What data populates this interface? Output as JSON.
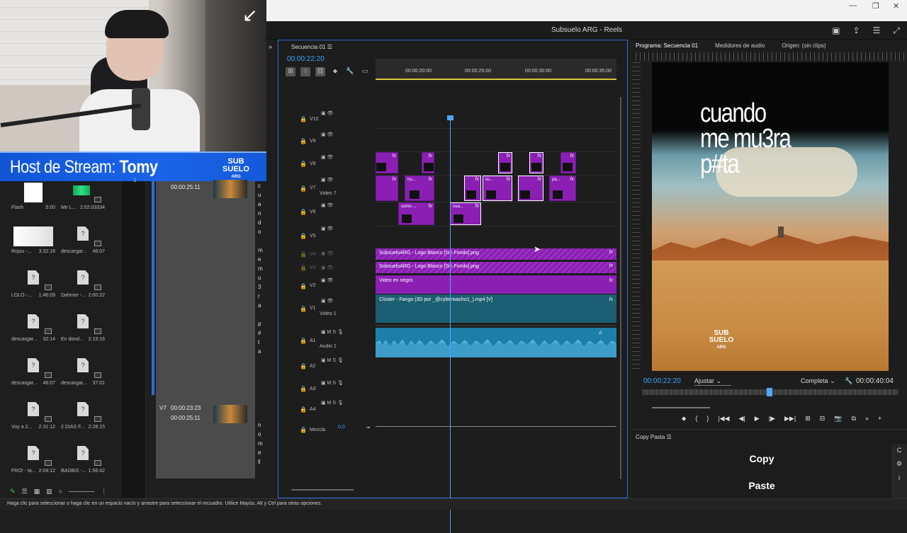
{
  "window": {
    "title": "Subsuelo ARG - Reels",
    "controls": [
      "—",
      "❐",
      "✕"
    ],
    "title_icons": [
      "▣",
      "⇪",
      "☰",
      "⤢"
    ]
  },
  "stream": {
    "banner_label": "Host de Stream:",
    "host_name": "Tomy",
    "logo_text": [
      "SUB",
      "SUELO",
      "ARG"
    ]
  },
  "project": {
    "items": [
      {
        "name": "Flash",
        "dur": "5:00",
        "kind": "white"
      },
      {
        "name": "Me L...",
        "dur": "2:02:03334",
        "kind": "audio"
      },
      {
        "name": "Rojuu -...",
        "dur": "3:32:18",
        "kind": "whiteimg"
      },
      {
        "name": "descargar...",
        "dur": "46:07",
        "kind": "doc"
      },
      {
        "name": "LOLO -...",
        "dur": "1:46:09",
        "kind": "doc"
      },
      {
        "name": "Dahmer -...",
        "dur": "2:00:22",
        "kind": "doc"
      },
      {
        "name": "descargar...",
        "dur": "32:14",
        "kind": "doc"
      },
      {
        "name": "En dond...",
        "dur": "2:19:16",
        "kind": "doc"
      },
      {
        "name": "descargar...",
        "dur": "46:07",
        "kind": "doc"
      },
      {
        "name": "descargar...",
        "dur": "37:01",
        "kind": "doc"
      },
      {
        "name": "Voy a 2...",
        "dur": "2:31:12",
        "kind": "doc"
      },
      {
        "name": "2 DIAS F...",
        "dur": "2:28:15",
        "kind": "doc"
      },
      {
        "name": "FRO! - ta...",
        "dur": "2:04:12",
        "kind": "doc"
      },
      {
        "name": "BADBIX -...",
        "dur": "1:56:42",
        "kind": "doc"
      }
    ],
    "tools": [
      "✎",
      "☰",
      "▦",
      "▥",
      "○",
      "⋮"
    ]
  },
  "captions": {
    "entries": [
      {
        "track": "",
        "in": "",
        "out": "00:00:25:11",
        "letters": [
          "c",
          "u",
          "a",
          "n",
          "d",
          "o",
          "",
          "m",
          "e",
          "m",
          "u",
          "3",
          "r",
          "a",
          "",
          "p",
          "#",
          "t",
          "a"
        ]
      },
      {
        "track": "V7",
        "in": "00:00:23:23",
        "out": "00:00:25:11",
        "letters": [
          "n",
          "o",
          "m",
          "e",
          "ll"
        ]
      }
    ],
    "left_marker": "1"
  },
  "timeline": {
    "tab": "Secuencia 01",
    "timecode": "00:00:22:20",
    "ruler": [
      "00:00:20:00",
      "00:00:25:00",
      "00:00:30:00",
      "00:00:35:00"
    ],
    "video_tracks": [
      {
        "id": "V10",
        "sub": ""
      },
      {
        "id": "V9",
        "sub": ""
      },
      {
        "id": "V8",
        "sub": ""
      },
      {
        "id": "V7",
        "sub": "Video 7"
      },
      {
        "id": "V6",
        "sub": ""
      },
      {
        "id": "V5",
        "sub": ""
      },
      {
        "id": "V4",
        "sub": ""
      },
      {
        "id": "V3",
        "sub": ""
      },
      {
        "id": "V2",
        "sub": ""
      },
      {
        "id": "V1",
        "sub": "Video 1"
      }
    ],
    "audio_tracks": [
      {
        "id": "A1",
        "sub": "Audio 1"
      },
      {
        "id": "A2",
        "sub": ""
      },
      {
        "id": "A3",
        "sub": ""
      },
      {
        "id": "A4",
        "sub": ""
      }
    ],
    "mix_label": "Mezcla",
    "mix_value": "0,0",
    "clips": {
      "v8": [
        "",
        "",
        "",
        "",
        ""
      ],
      "v7": [
        "",
        "hu...",
        "",
        "cu...",
        "",
        "pa..."
      ],
      "v6": [
        "como ...",
        "cua..."
      ],
      "v4": "SubsueloARG - Logo Blanco [Sin Fondo].png",
      "v3": "SubsueloARG - Logo Blanco [Sin Fondo].png",
      "v2": "Video en negro",
      "v1": "Clúster - Fango (3D por _@cyberwacho1_).mp4 [V]",
      "fx": "fx"
    }
  },
  "program": {
    "tabs": [
      "Programa: Secuencia 01",
      "Medidores de audio",
      "Origen: (sin clips)"
    ],
    "caption_text": [
      "cuando",
      "me mu3ra",
      "p#ta"
    ],
    "timecode": "00:00:22:20",
    "fit": "Ajustar",
    "quality": "Completa",
    "duration": "00:00:40:04",
    "transport": [
      "⬥",
      "{",
      "}",
      "|◀◀",
      "◀|",
      "▶",
      "|▶",
      "▶▶|",
      "⊞",
      "⊟",
      "📷",
      "⧉",
      "»",
      "+"
    ]
  },
  "copy_paste": {
    "title": "Copy Pasta",
    "copy": "Copy",
    "paste": "Paste",
    "side_icons": [
      "C",
      "⚙",
      "i"
    ]
  },
  "status": {
    "text": "Haga clic para seleccionar o haga clic en un espacio vacío y arrastre para seleccionar el recuadro. Utilice Mayús, Alt y Ctrl para otras opciones."
  },
  "colors": {
    "accent_blue": "#3aa3ff",
    "clip_purple": "#8b1fb4",
    "clip_teal": "#1c5f73",
    "audio_wave": "#5fb8e6",
    "banner_blue": "#1a63e8"
  }
}
